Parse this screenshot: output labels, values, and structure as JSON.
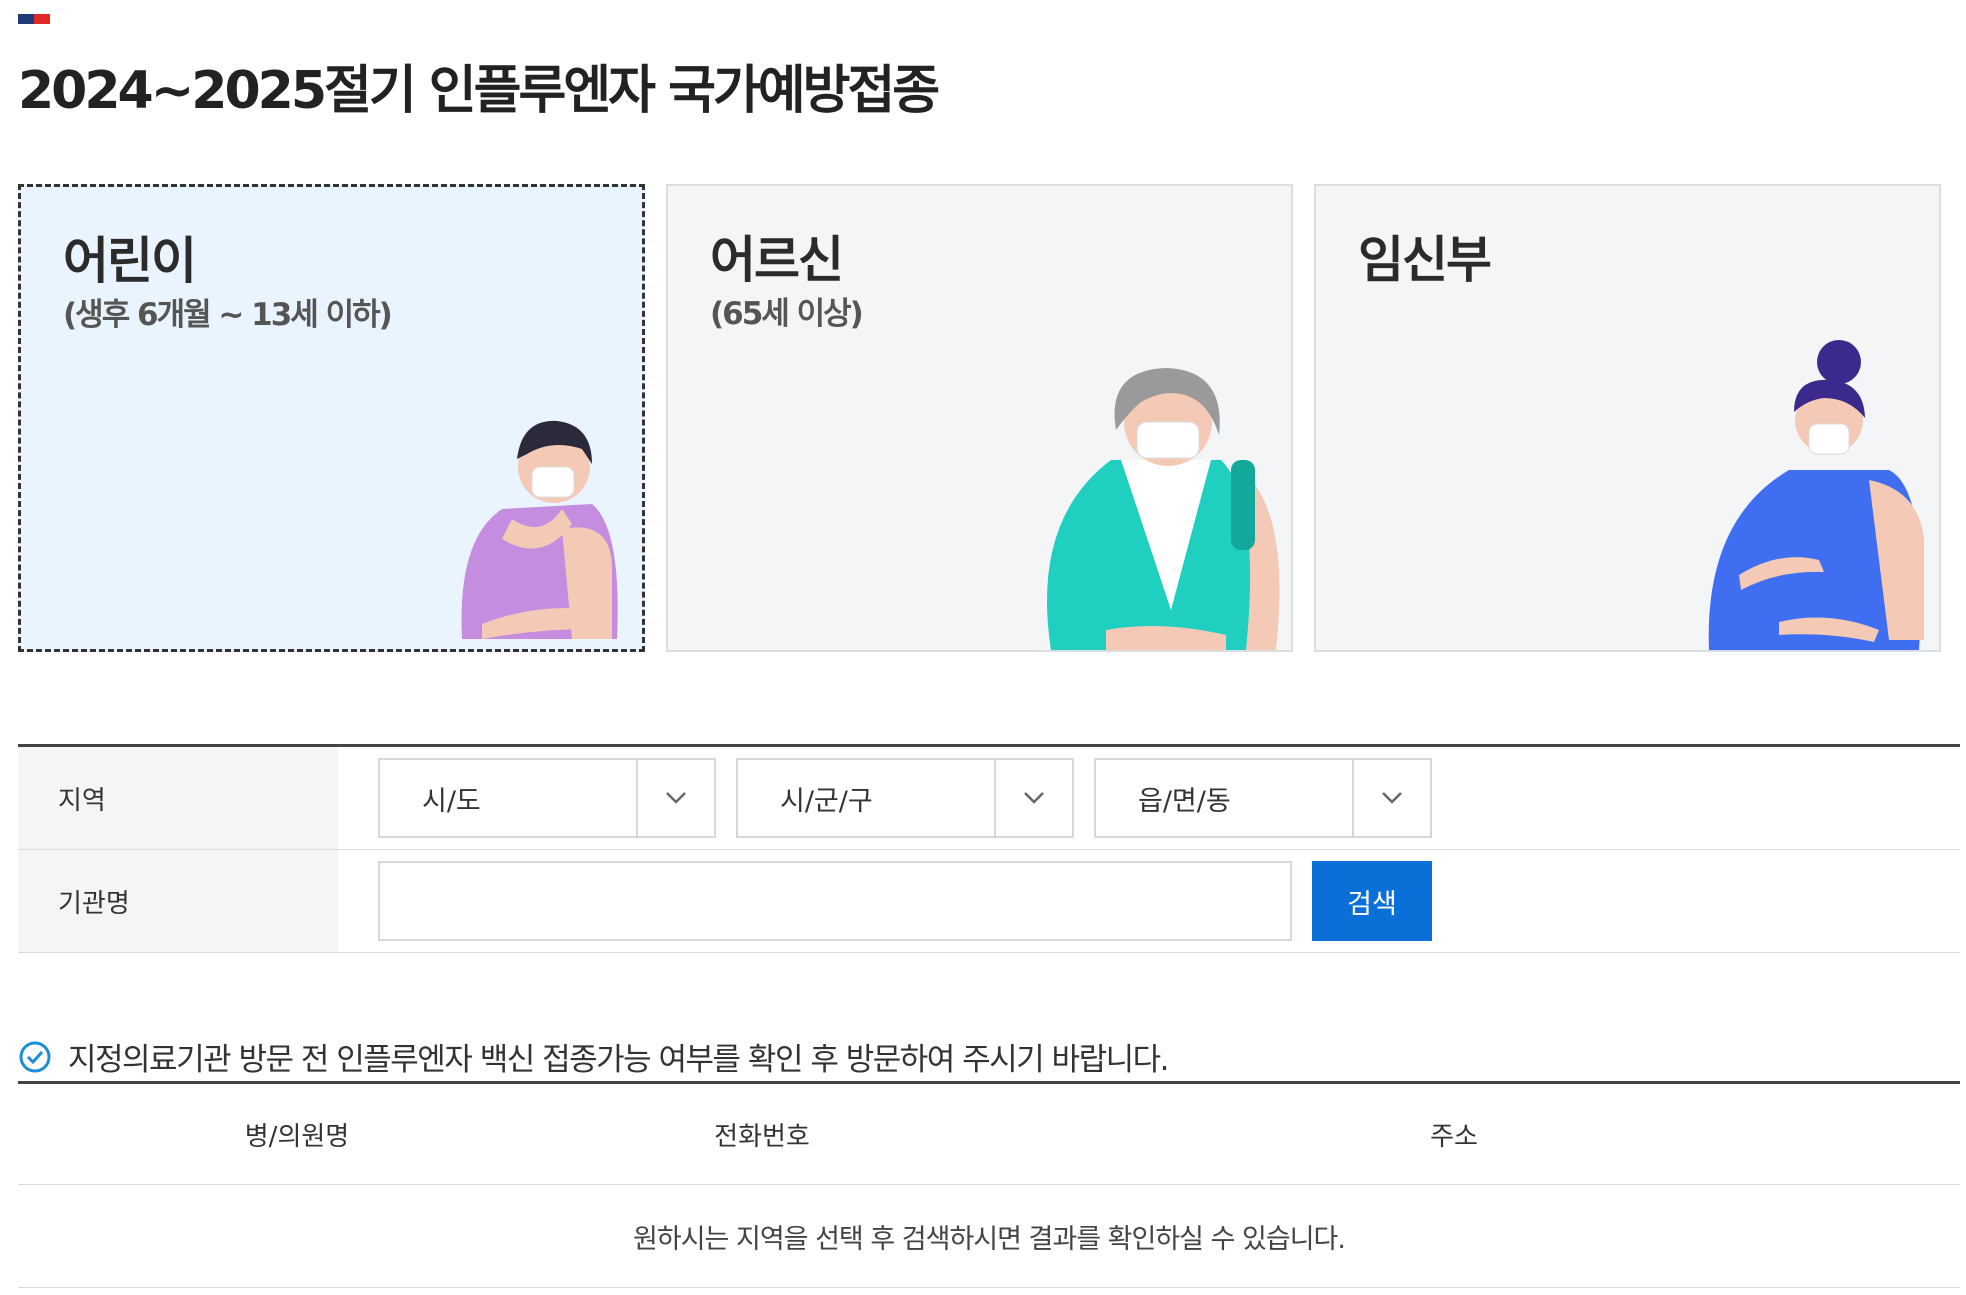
{
  "page": {
    "title": "2024~2025절기 인플루엔자 국가예방접종",
    "flag_colors": [
      "#1f3b7a",
      "#e02a2a"
    ]
  },
  "target_cards": [
    {
      "title": "어린이",
      "subtitle": "(생후 6개월 ~ 13세 이하)",
      "selected": true
    },
    {
      "title": "어르신",
      "subtitle": "(65세 이상)",
      "selected": false
    },
    {
      "title": "임신부",
      "subtitle": "",
      "selected": false
    }
  ],
  "search": {
    "region_label": "지역",
    "sido": "시/도",
    "sigungu": "시/군/구",
    "eupmyeondong": "읍/면/동",
    "institution_label": "기관명",
    "institution_value": "",
    "search_button": "검색"
  },
  "notice": "지정의료기관 방문 전 인플루엔자 백신 접종가능 여부를 확인 후 방문하여 주시기 바랍니다.",
  "results": {
    "columns": [
      "병/의원명",
      "전화번호",
      "주소"
    ],
    "empty_message": "원하시는 지역을 선택 후 검색하시면 결과를 확인하실 수 있습니다."
  },
  "colors": {
    "accent": "#0b6fd8",
    "selected_card_bg": "#e9f4ff",
    "card_bg": "#f4f5f7",
    "notice_icon": "#1a8fd8"
  },
  "icons": [
    "check-circle-icon",
    "chevron-down-icon"
  ]
}
